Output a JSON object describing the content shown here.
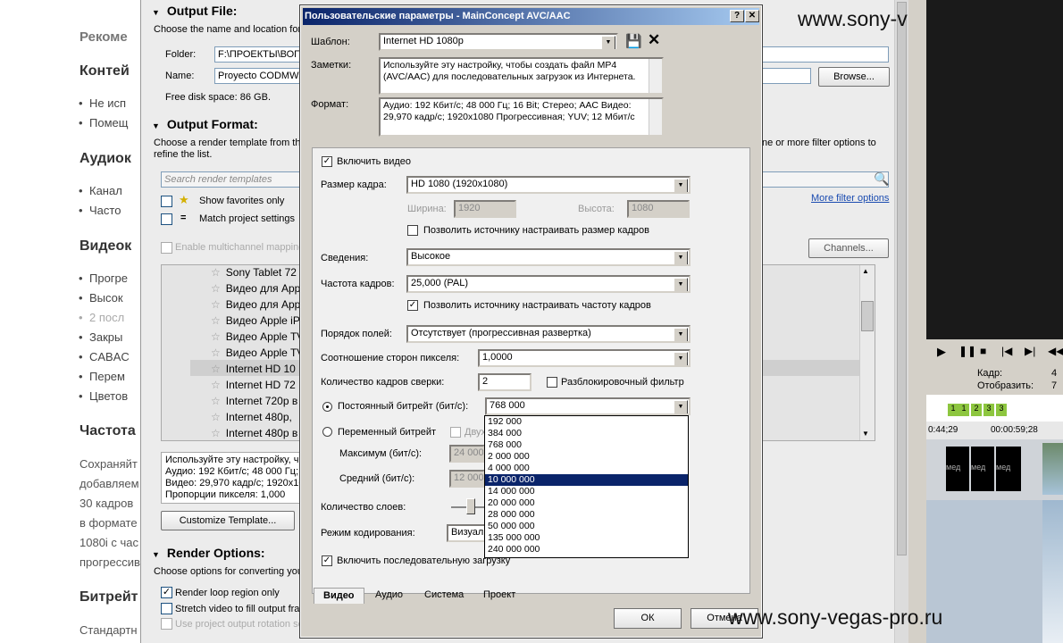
{
  "article": {
    "h1": "Рекоме",
    "h2": "Контей",
    "li1": "Не исп",
    "li2": "Помещ",
    "h3": "Аудиок",
    "li3": "Канал",
    "li4": "Часто",
    "h4": "Видеок",
    "li5": "Прогре",
    "li6": "Высок",
    "li7": "2 посл",
    "li8": "Закры",
    "li9": "CABAC",
    "li10": "Перем",
    "li11": "Цветов",
    "h5": "Частота",
    "p1": "Сохраняйт",
    "p2": "добавляем",
    "p3": "30 кадров",
    "p4": "в формате",
    "p5": "1080i с час",
    "p6": "прогрессив",
    "h6": "Битрейт",
    "p7": "Стандартн"
  },
  "render": {
    "output_file": "Output File:",
    "output_file_desc": "Choose the name and location for",
    "folder_label": "Folder:",
    "folder_value": "F:\\ПРОЕКТЫ\\ВОП",
    "name_label": "Name:",
    "name_value": "Proyecto CODMW.r",
    "browse": "Browse...",
    "free_space": "Free disk space: 86 GB.",
    "output_format": "Output Format:",
    "output_format_desc1": "Choose a render template from th",
    "output_format_desc2": "refine the list.",
    "filter_desc": "ne or more filter options to",
    "search_placeholder": "Search render templates",
    "show_favorites": "Show favorites only",
    "match_project": "Match project settings",
    "more_filter": "More filter options",
    "multichannel": "Enable multichannel mapping",
    "channels": "Channels...",
    "templates": [
      "Sony Tablet 72",
      "Видео для App",
      "Видео для App",
      "Видео Apple iP",
      "Видео Apple TV",
      "Видео Apple TV",
      "Internet HD 10",
      "Internet HD 72",
      "Internet 720p в",
      "Internet 480p,",
      "Internet 480p в"
    ],
    "desc1": "Используйте эту настройку, ч",
    "desc2": "Аудио: 192 Кбит/с; 48 000 Гц;",
    "desc3": "Видео: 29,970 кадр/с; 1920x10",
    "desc4": "Пропорции пикселя: 1,000",
    "customize": "Customize Template...",
    "render_options": "Render Options:",
    "render_options_desc": "Choose options for converting you",
    "loop": "Render loop region only",
    "stretch": "Stretch video to fill output fra",
    "use_project": "Use project output rotation se"
  },
  "editor": {
    "frame_label": "Кадр:",
    "frame_value": "4",
    "display_label": "Отобразить:",
    "display_value": "7",
    "tc1": "0:44;29",
    "tc2": "00:00:59;28",
    "markers": [
      "1",
      "1",
      "2",
      "3",
      "3"
    ],
    "clip": "мед"
  },
  "dialog": {
    "title": "Пользовательские параметры - MainConcept AVC/AAC",
    "help": "?",
    "close": "✕",
    "template_label": "Шаблон:",
    "template_value": "Internet HD 1080p",
    "notes_label": "Заметки:",
    "notes_value": "Используйте эту настройку, чтобы создать файл MP4 (AVC/AAC) для последовательных загрузок из Интернета.",
    "format_label": "Формат:",
    "format_value": "Аудио: 192 Кбит/с; 48 000 Гц; 16 Bit; Стерео; AAC Видео: 29,970 кадр/с; 1920x1080 Прогрессивная; YUV; 12 Мбит/с",
    "enable_video": "Включить видео",
    "frame_size_label": "Размер кадра:",
    "frame_size_value": "HD 1080 (1920x1080)",
    "width_label": "Ширина:",
    "width_value": "1920",
    "height_label": "Высота:",
    "height_value": "1080",
    "allow_size": "Позволить источнику настраивать размер кадров",
    "profile_label": "Сведения:",
    "profile_value": "Высокое",
    "fps_label": "Частота кадров:",
    "fps_value": "25,000 (PAL)",
    "allow_fps": "Позволить источнику настраивать частоту кадров",
    "field_order_label": "Порядок полей:",
    "field_order_value": "Отсутствует (прогрессивная развертка)",
    "par_label": "Соотношение сторон пикселя:",
    "par_value": "1,0000",
    "ref_frames_label": "Количество кадров сверки:",
    "ref_frames_value": "2",
    "deblock": "Разблокировочный фильтр",
    "cbr_label": "Постоянный битрейт (бит/с):",
    "cbr_value": "768 000",
    "vbr_label": "Переменный битрейт",
    "two_pass": "Двух",
    "max_label": "Максимум (бит/с):",
    "max_value": "24 000",
    "avg_label": "Средний (бит/с):",
    "avg_value": "12 000",
    "slices_label": "Количество слоев:",
    "encode_mode_label": "Режим кодирования:",
    "encode_mode_value": "Визуали",
    "progressive_dl": "Включить последовательную загрузку",
    "bitrate_options": [
      "192 000",
      "384 000",
      "768 000",
      "2 000 000",
      "4 000 000",
      "10 000 000",
      "14 000 000",
      "20 000 000",
      "28 000 000",
      "50 000 000",
      "135 000 000",
      "240 000 000"
    ],
    "tabs": [
      "Видео",
      "Аудио",
      "Система",
      "Проект"
    ],
    "ok": "ОК",
    "cancel": "Отмена"
  },
  "watermark": {
    "top": "www.sony-v",
    "bottom": "www.sony-vegas-pro.ru"
  }
}
